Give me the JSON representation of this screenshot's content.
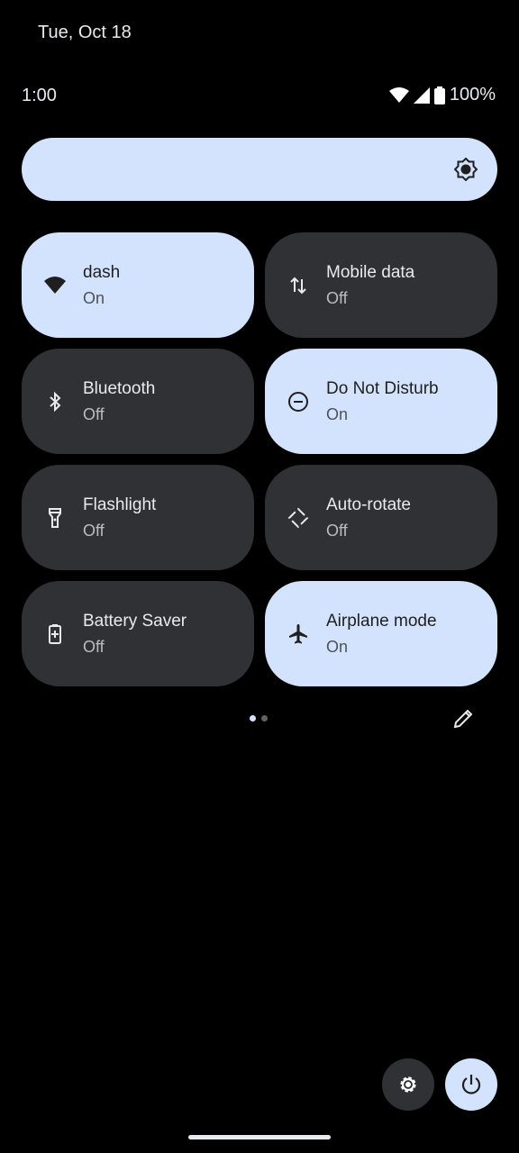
{
  "header": {
    "date": "Tue, Oct 18",
    "time": "1:00",
    "battery": "100%"
  },
  "brightness": {
    "icon": "brightness-icon"
  },
  "tiles": [
    {
      "label": "dash",
      "state": "On",
      "icon": "wifi-icon",
      "active": true
    },
    {
      "label": "Mobile data",
      "state": "Off",
      "icon": "mobile-data-icon",
      "active": false
    },
    {
      "label": "Bluetooth",
      "state": "Off",
      "icon": "bluetooth-icon",
      "active": false
    },
    {
      "label": "Do Not Disturb",
      "state": "On",
      "icon": "dnd-icon",
      "active": true
    },
    {
      "label": "Flashlight",
      "state": "Off",
      "icon": "flashlight-icon",
      "active": false
    },
    {
      "label": "Auto-rotate",
      "state": "Off",
      "icon": "rotate-icon",
      "active": false
    },
    {
      "label": "Battery Saver",
      "state": "Off",
      "icon": "battery-saver-icon",
      "active": false
    },
    {
      "label": "Airplane mode",
      "state": "On",
      "icon": "airplane-icon",
      "active": true
    }
  ],
  "pager": {
    "current": 1,
    "total": 2
  },
  "colors": {
    "active": "#d3e3fd",
    "inactive": "#303134"
  }
}
